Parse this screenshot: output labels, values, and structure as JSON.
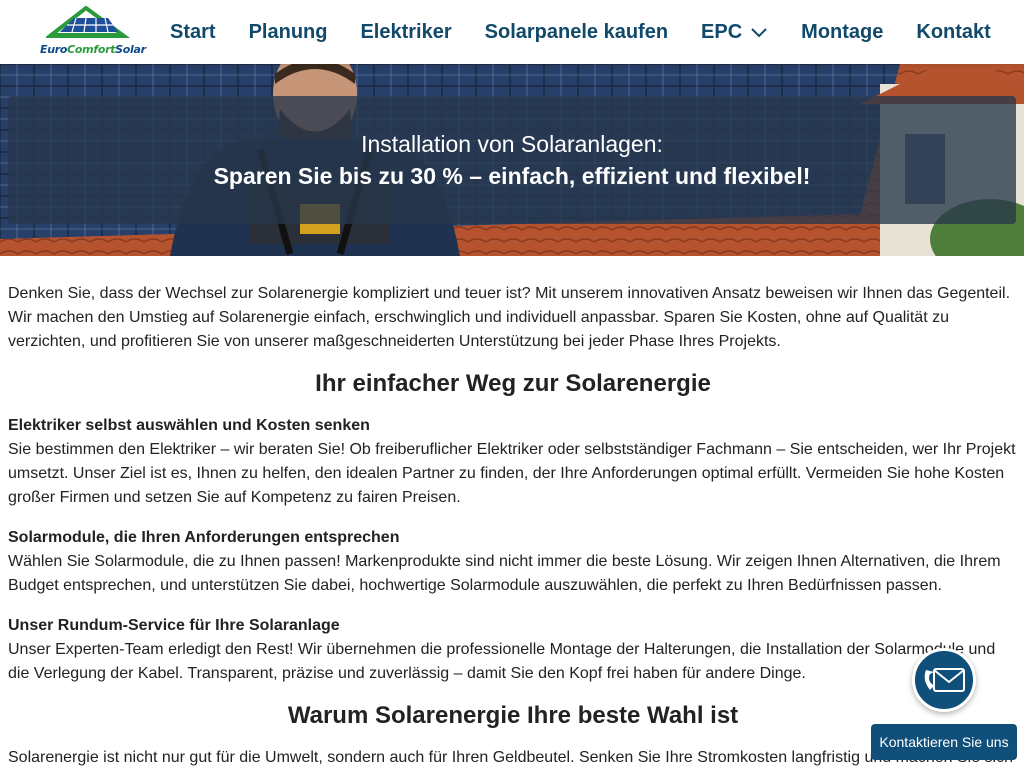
{
  "logo": {
    "word1": "Euro",
    "word2": "Comfort",
    "word3": "Solar"
  },
  "nav": {
    "items": [
      {
        "label": "Start"
      },
      {
        "label": "Planung"
      },
      {
        "label": "Elektriker"
      },
      {
        "label": "Solarpanele kaufen"
      },
      {
        "label": "EPC"
      },
      {
        "label": "Montage"
      },
      {
        "label": "Kontakt"
      }
    ],
    "epc_icon": "chevron-down-icon"
  },
  "hero": {
    "line1": "Installation von Solaranlagen:",
    "line2": "Sparen Sie bis zu 30 % – einfach, effizient und flexibel!"
  },
  "content": {
    "intro": "Denken Sie, dass der Wechsel zur Solarenergie kompliziert und teuer ist? Mit unserem innovativen Ansatz beweisen wir Ihnen das Gegenteil. Wir machen den Umstieg auf Solarenergie einfach, erschwinglich und individuell anpassbar. Sparen Sie Kosten, ohne auf Qualität zu verzichten, und profitieren Sie von unserer maßgeschneiderten Unterstützung bei jeder Phase Ihres Projekts.",
    "heading1": "Ihr einfacher Weg zur Solarenergie",
    "sections": [
      {
        "title": "Elektriker selbst auswählen und Kosten senken",
        "text": "Sie bestimmen den Elektriker – wir beraten Sie! Ob freiberuflicher Elektriker oder selbstständiger Fachmann – Sie entscheiden, wer Ihr Projekt umsetzt. Unser Ziel ist es, Ihnen zu helfen, den idealen Partner zu finden, der Ihre Anforderungen optimal erfüllt. Vermeiden Sie hohe Kosten großer Firmen und setzen Sie auf Kompetenz zu fairen Preisen."
      },
      {
        "title": "Solarmodule, die Ihren Anforderungen entsprechen",
        "text": "Wählen Sie Solarmodule, die zu Ihnen passen! Markenprodukte sind nicht immer die beste Lösung. Wir zeigen Ihnen Alternativen, die Ihrem Budget entsprechen, und unterstützen Sie dabei, hochwertige Solarmodule auszuwählen, die perfekt zu Ihren Bedürfnissen passen."
      },
      {
        "title": "Unser Rundum-Service für Ihre Solaranlage",
        "text": "Unser Experten-Team erledigt den Rest! Wir übernehmen die professionelle Montage der Halterungen, die Installation der Solarmodule und die Verlegung der Kabel. Transparent, präzise und zuverlässig – damit Sie den Kopf frei haben für andere Dinge."
      }
    ],
    "heading2": "Warum Solarenergie Ihre beste Wahl ist",
    "closing": "Solarenergie ist nicht nur gut für die Umwelt, sondern auch für Ihren Geldbeutel. Senken Sie Ihre Stromkosten langfristig und machen Sie sich unabhängiger von steigenden Energiepreisen."
  },
  "contact_widget": {
    "icon": "phone-mail-icon",
    "label": "Kontaktieren Sie uns"
  },
  "colors": {
    "nav_text": "#11496b",
    "hero_overlay": "#283746",
    "widget_bg": "#0f4f7a",
    "logo_blue": "#0e4a8a",
    "logo_green": "#2a9a3a"
  }
}
